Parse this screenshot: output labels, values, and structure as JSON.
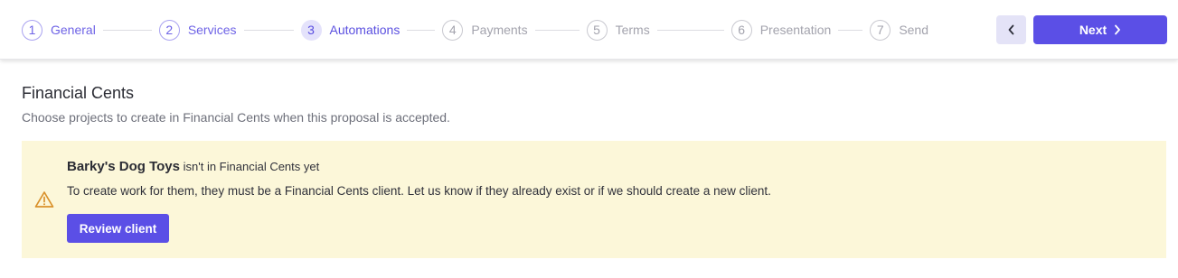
{
  "stepper": {
    "steps": [
      {
        "number": "1",
        "label": "General",
        "state": "done"
      },
      {
        "number": "2",
        "label": "Services",
        "state": "done"
      },
      {
        "number": "3",
        "label": "Automations",
        "state": "active"
      },
      {
        "number": "4",
        "label": "Payments",
        "state": "upcoming"
      },
      {
        "number": "5",
        "label": "Terms",
        "state": "upcoming"
      },
      {
        "number": "6",
        "label": "Presentation",
        "state": "upcoming"
      },
      {
        "number": "7",
        "label": "Send",
        "state": "upcoming"
      }
    ]
  },
  "nav": {
    "back_icon": "chevron-left-icon",
    "next_label": "Next",
    "next_icon": "chevron-right-icon"
  },
  "section": {
    "title": "Financial Cents",
    "subtitle": "Choose projects to create in Financial Cents when this proposal is accepted."
  },
  "alert": {
    "icon": "warning-triangle-icon",
    "client_name": "Barky's Dog Toys",
    "title_suffix": "isn't in Financial Cents yet",
    "body": "To create work for them, they must be a Financial Cents client. Let us know if they already exist or if we should create a new client.",
    "button_label": "Review client"
  },
  "colors": {
    "accent": "#5b4fe6",
    "alert_background": "#fcf7d9",
    "warning_icon": "#d9912b"
  }
}
